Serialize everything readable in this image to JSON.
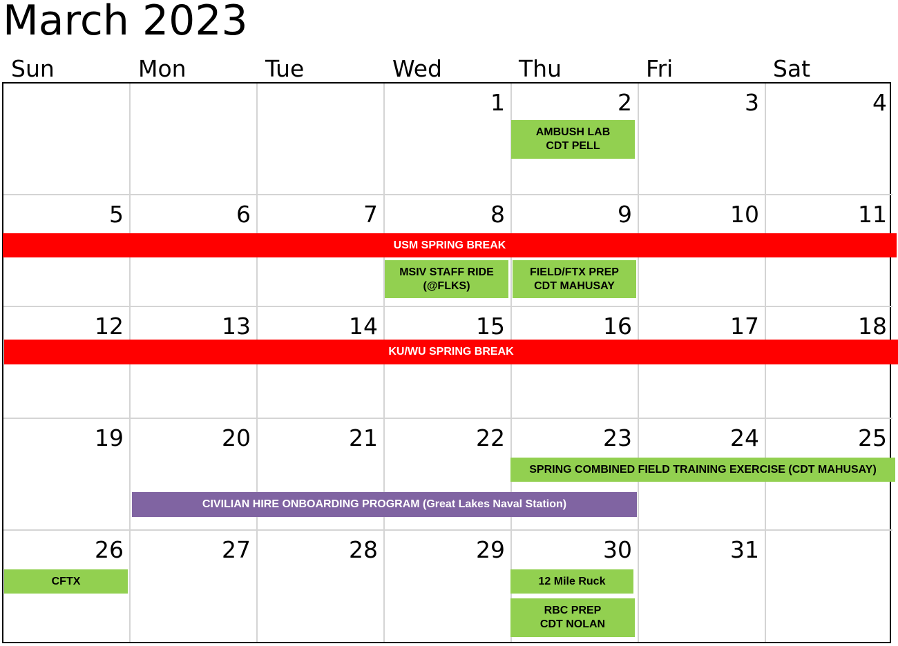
{
  "calendar": {
    "title": "March 2023",
    "weekdays": [
      "Sun",
      "Mon",
      "Tue",
      "Wed",
      "Thu",
      "Fri",
      "Sat"
    ],
    "weeks": [
      [
        "",
        "",
        "",
        "1",
        "2",
        "3",
        "4"
      ],
      [
        "5",
        "6",
        "7",
        "8",
        "9",
        "10",
        "11"
      ],
      [
        "12",
        "13",
        "14",
        "15",
        "16",
        "17",
        "18"
      ],
      [
        "19",
        "20",
        "21",
        "22",
        "23",
        "24",
        "25"
      ],
      [
        "26",
        "27",
        "28",
        "29",
        "30",
        "31",
        ""
      ]
    ]
  },
  "events": {
    "ambush_lab": [
      "AMBUSH LAB",
      "CDT PELL"
    ],
    "usm_break": "USM SPRING BREAK",
    "msiv_staff_ride": [
      "MSIV STAFF RIDE",
      "(@FLKS)"
    ],
    "field_ftx_prep": [
      "FIELD/FTX PREP",
      "CDT MAHUSAY"
    ],
    "ku_wu_break": "KU/WU SPRING BREAK",
    "spring_cftx": "SPRING COMBINED FIELD TRAINING EXERCISE (CDT MAHUSAY)",
    "civilian_hire": "CIVILIAN HIRE ONBOARDING PROGRAM (Great Lakes Naval Station)",
    "cftx": "CFTX",
    "ruck": "12 Mile Ruck",
    "rbc_prep": [
      "RBC PREP",
      "CDT NOLAN"
    ]
  },
  "colors": {
    "green": "#92d050",
    "red": "#ff0000",
    "purple": "#8064a2",
    "grid_line": "#d4d4d4"
  }
}
